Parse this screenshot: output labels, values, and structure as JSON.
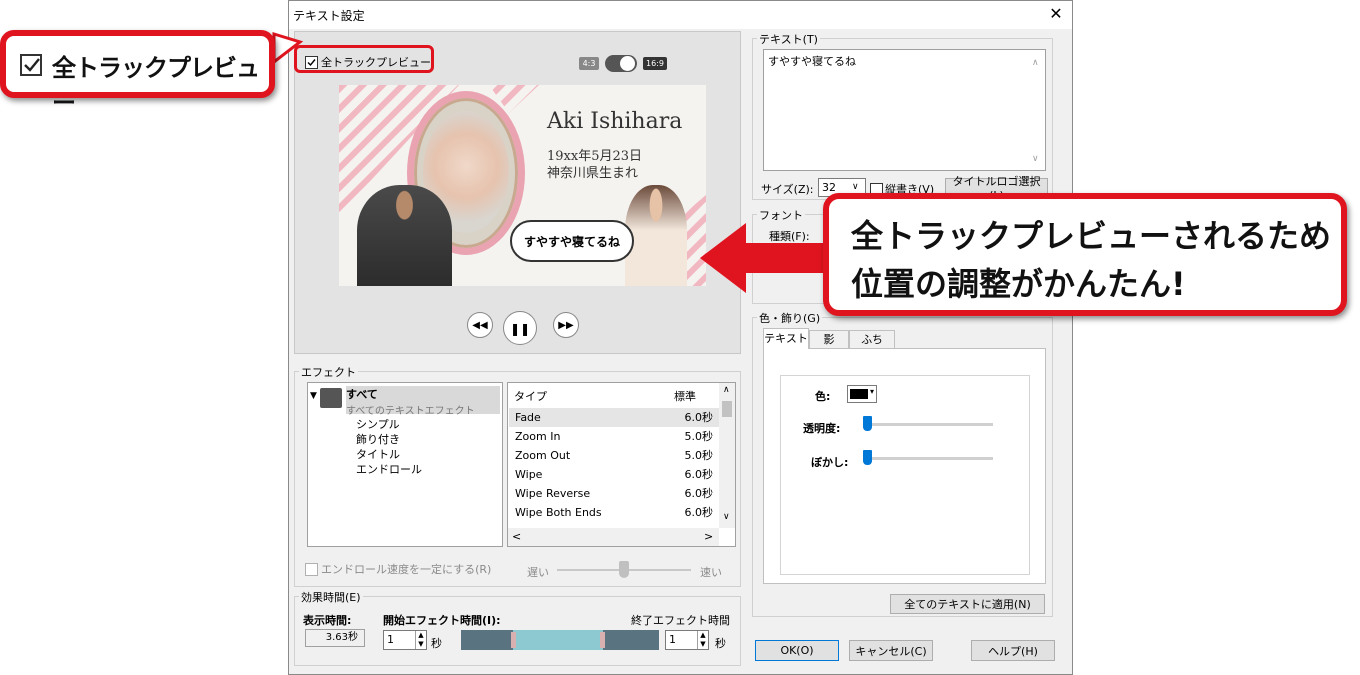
{
  "dialog": {
    "title": "テキスト設定",
    "close_glyph": "✕"
  },
  "preview": {
    "all_track_label": "全トラックプレビュー",
    "ratio_43": "4:3",
    "ratio_169": "16:9",
    "name": "Aki Ishihara",
    "date": "19xx年5月23日",
    "place": "神奈川県生まれ",
    "bubble": "すやすや寝てるね"
  },
  "effects": {
    "group_label": "エフェクト",
    "tree_all": "すべて",
    "tree_all_sub": "すべてのテキストエフェクト",
    "tree_items": [
      "シンプル",
      "飾り付き",
      "タイトル",
      "エンドロール"
    ],
    "col_type": "タイプ",
    "col_std": "標準",
    "rows": [
      {
        "name": "Fade",
        "dur": "6.0秒"
      },
      {
        "name": "Zoom In",
        "dur": "5.0秒"
      },
      {
        "name": "Zoom Out",
        "dur": "5.0秒"
      },
      {
        "name": "Wipe",
        "dur": "6.0秒"
      },
      {
        "name": "Wipe Reverse",
        "dur": "6.0秒"
      },
      {
        "name": "Wipe Both Ends",
        "dur": "6.0秒"
      }
    ],
    "endroll_label": "エンドロール速度を一定にする(R)",
    "slow": "遅い",
    "fast": "速い"
  },
  "timing": {
    "group_label": "効果時間(E)",
    "display_label": "表示時間:",
    "display_value": "3.63秒",
    "start_label": "開始エフェクト時間(I):",
    "start_value": "1",
    "end_label": "終了エフェクト時間(J):",
    "end_value": "1",
    "sec": "秒"
  },
  "text": {
    "group_label": "テキスト(T)",
    "value": "すやすや寝てるね",
    "size_label": "サイズ(Z):",
    "size_value": "32",
    "vertical_label": "縦書き(V)",
    "title_logo_button": "タイトルロゴ選択(L)"
  },
  "font": {
    "group_label": "フォント",
    "type_label": "種類(F):"
  },
  "color": {
    "group_label": "色・飾り(G)",
    "tabs": [
      "テキスト",
      "影",
      "ふち"
    ],
    "color_label": "色:",
    "opacity_label": "透明度:",
    "blur_label": "ぼかし:",
    "swatch_color": "#000000",
    "apply_all_button": "全てのテキストに適用(N)"
  },
  "buttons": {
    "ok": "OK(O)",
    "cancel": "キャンセル(C)",
    "help": "ヘルプ(H)"
  },
  "callouts": {
    "small": "全トラックプレビュー",
    "big_line1": "全トラックプレビューされるため",
    "big_line2": "位置の調整がかんたん!",
    "accent": "#e0141e"
  }
}
